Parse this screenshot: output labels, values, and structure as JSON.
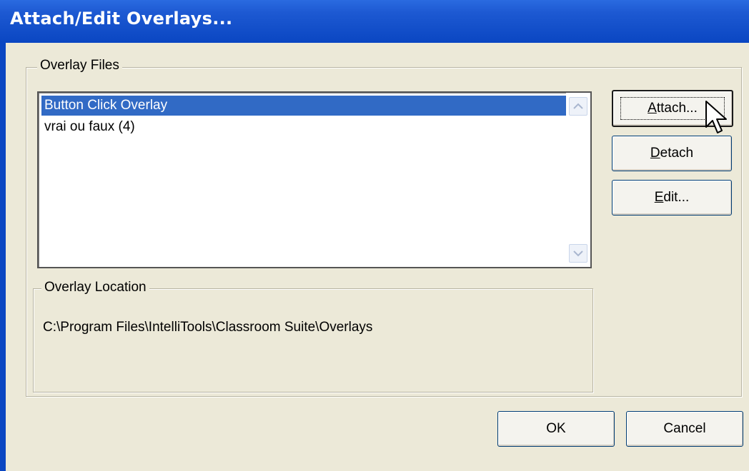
{
  "window": {
    "title": "Attach/Edit Overlays..."
  },
  "overlay_files": {
    "label": "Overlay Files",
    "items": [
      {
        "label": "Button Click Overlay",
        "selected": true
      },
      {
        "label": "vrai ou faux (4)",
        "selected": false
      }
    ]
  },
  "overlay_location": {
    "label": "Overlay Location",
    "path": "C:\\Program Files\\IntelliTools\\Classroom Suite\\Overlays"
  },
  "buttons": {
    "attach": {
      "mnemonic": "A",
      "rest": "ttach..."
    },
    "detach": {
      "mnemonic": "D",
      "rest": "etach"
    },
    "edit": {
      "mnemonic": "E",
      "rest": "dit..."
    },
    "ok": "OK",
    "cancel": "Cancel"
  },
  "colors": {
    "titlebar": "#0a46c2",
    "selection": "#316ac5",
    "dialog_bg": "#ece9d8"
  },
  "icons": {
    "cursor": "arrow-cursor-icon",
    "scroll_up": "scroll-up-arrow-icon",
    "scroll_down": "scroll-down-arrow-icon"
  }
}
